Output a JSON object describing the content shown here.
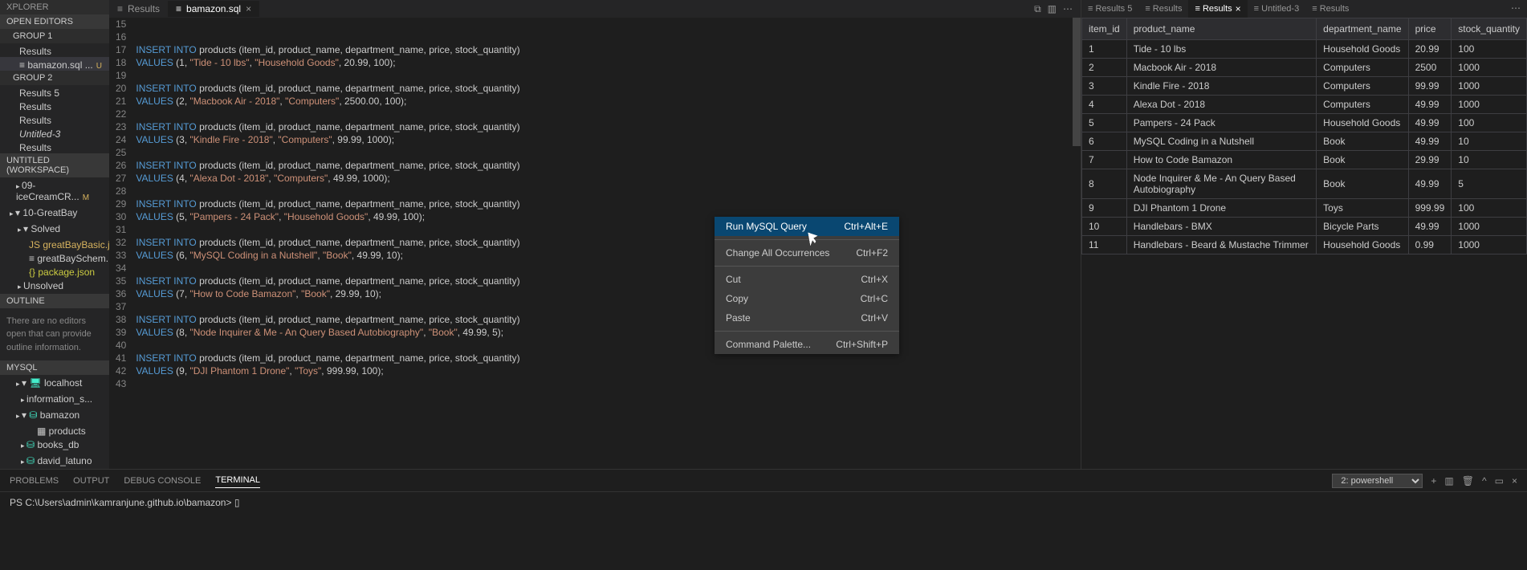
{
  "sidebar": {
    "title": "XPLORER",
    "section_editors": "OPEN EDITORS",
    "group1": "GROUP 1",
    "group2": "GROUP 2",
    "workspace": "UNTITLED (WORKSPACE)",
    "outline": "OUTLINE",
    "mysql": "MYSQL",
    "g1_results": "Results",
    "g1_bamazon": "bamazon.sql ...",
    "g1_modified": "U",
    "g2_results5": "Results 5",
    "g2_results": "Results",
    "g2_results2": "Results",
    "g2_untitled3": "Untitled-3",
    "g2_results3": "Results",
    "ws_ice": "09-iceCreamCR...",
    "ws_greatbay": "10-GreatBay",
    "ws_solved": "Solved",
    "ws_gbjs": "greatBayBasic.js",
    "ws_gbschem": "greatBaySchem...",
    "ws_pkg": "package.json",
    "ws_unsolved": "Unsolved",
    "outline_msg": "There are no editors open that can provide outline information.",
    "my_localhost": "localhost",
    "my_info": "information_s...",
    "my_bamazon": "bamazon",
    "my_products": "products",
    "my_booksdb": "books_db",
    "my_david": "david_latuno"
  },
  "editor": {
    "tab1": "Results",
    "tab2": "bamazon.sql",
    "tab2_close": "×",
    "lines": [
      15,
      16,
      17,
      18,
      19,
      20,
      21,
      22,
      23,
      24,
      25,
      26,
      27,
      28,
      29,
      30,
      31,
      32,
      33,
      34,
      35,
      36,
      37,
      38,
      39,
      40,
      41,
      42,
      43
    ]
  },
  "code": {
    "l15": "",
    "l16": "",
    "ins": "INSERT",
    "into": "INTO",
    "prod": " products (item_id, product_name, department_name, price, stock_quantity)",
    "val": "VALUES",
    "v1": " (1, ",
    "s1a": "\"Tide - 10 lbs\"",
    "c1": ", ",
    "s1b": "\"Household Goods\"",
    "e1": ", 20.99, 100);",
    "v2": " (2, ",
    "s2a": "\"Macbook Air - 2018\"",
    "s2b": "\"Computers\"",
    "e2": ", 2500.00, 100);",
    "v3": " (3, ",
    "s3a": "\"Kindle Fire - 2018\"",
    "s3b": "\"Computers\"",
    "e3": ", 99.99, 1000);",
    "v4": " (4, ",
    "s4a": "\"Alexa Dot - 2018\"",
    "s4b": "\"Computers\"",
    "e4": ", 49.99, 1000);",
    "v5": " (5, ",
    "s5a": "\"Pampers - 24 Pack\"",
    "s5b": "\"Household Goods\"",
    "e5": ", 49.99, 100);",
    "v6": " (6, ",
    "s6a": "\"MySQL Coding in a Nutshell\"",
    "s6b": "\"Book\"",
    "e6": ", 49.99, 10);",
    "v7": " (7, ",
    "s7a": "\"How to Code Bamazon\"",
    "s7b": "\"Book\"",
    "e7": ", 29.99, 10);",
    "v8": " (8, ",
    "s8a": "\"Node Inquirer & Me - An Query Based Autobiography\"",
    "s8b": "\"Book\"",
    "e8": ", 49.99, 5);",
    "v9": " (9, ",
    "s9a": "\"DJI Phantom 1 Drone\"",
    "s9b": "\"Toys\"",
    "e9": ", 999.99, 100);"
  },
  "context": {
    "run": "Run MySQL Query",
    "run_key": "Ctrl+Alt+E",
    "change": "Change All Occurrences",
    "change_key": "Ctrl+F2",
    "cut": "Cut",
    "cut_key": "Ctrl+X",
    "copy": "Copy",
    "copy_key": "Ctrl+C",
    "paste": "Paste",
    "paste_key": "Ctrl+V",
    "palette": "Command Palette...",
    "palette_key": "Ctrl+Shift+P"
  },
  "results": {
    "tabs": [
      "Results 5",
      "Results",
      "Results",
      "Untitled-3",
      "Results"
    ],
    "active_tab": 2,
    "headers": [
      "item_id",
      "product_name",
      "department_name",
      "price",
      "stock_quantity"
    ],
    "rows": [
      [
        "1",
        "Tide - 10 lbs",
        "Household Goods",
        "20.99",
        "100"
      ],
      [
        "2",
        "Macbook Air - 2018",
        "Computers",
        "2500",
        "1000"
      ],
      [
        "3",
        "Kindle Fire - 2018",
        "Computers",
        "99.99",
        "1000"
      ],
      [
        "4",
        "Alexa Dot - 2018",
        "Computers",
        "49.99",
        "1000"
      ],
      [
        "5",
        "Pampers - 24 Pack",
        "Household Goods",
        "49.99",
        "100"
      ],
      [
        "6",
        "MySQL Coding in a Nutshell",
        "Book",
        "49.99",
        "10"
      ],
      [
        "7",
        "How to Code Bamazon",
        "Book",
        "29.99",
        "10"
      ],
      [
        "8",
        "Node Inquirer & Me - An Query Based Autobiography",
        "Book",
        "49.99",
        "5"
      ],
      [
        "9",
        "DJI Phantom 1 Drone",
        "Toys",
        "999.99",
        "100"
      ],
      [
        "10",
        "Handlebars - BMX",
        "Bicycle Parts",
        "49.99",
        "1000"
      ],
      [
        "11",
        "Handlebars - Beard & Mustache Trimmer",
        "Household Goods",
        "0.99",
        "1000"
      ]
    ]
  },
  "panel": {
    "problems": "PROBLEMS",
    "output": "OUTPUT",
    "debug": "DEBUG CONSOLE",
    "terminal": "TERMINAL",
    "term_select": "2: powershell",
    "prompt": "PS C:\\Users\\admin\\kamranjune.github.io\\bamazon> ",
    "cursor": "▯"
  }
}
